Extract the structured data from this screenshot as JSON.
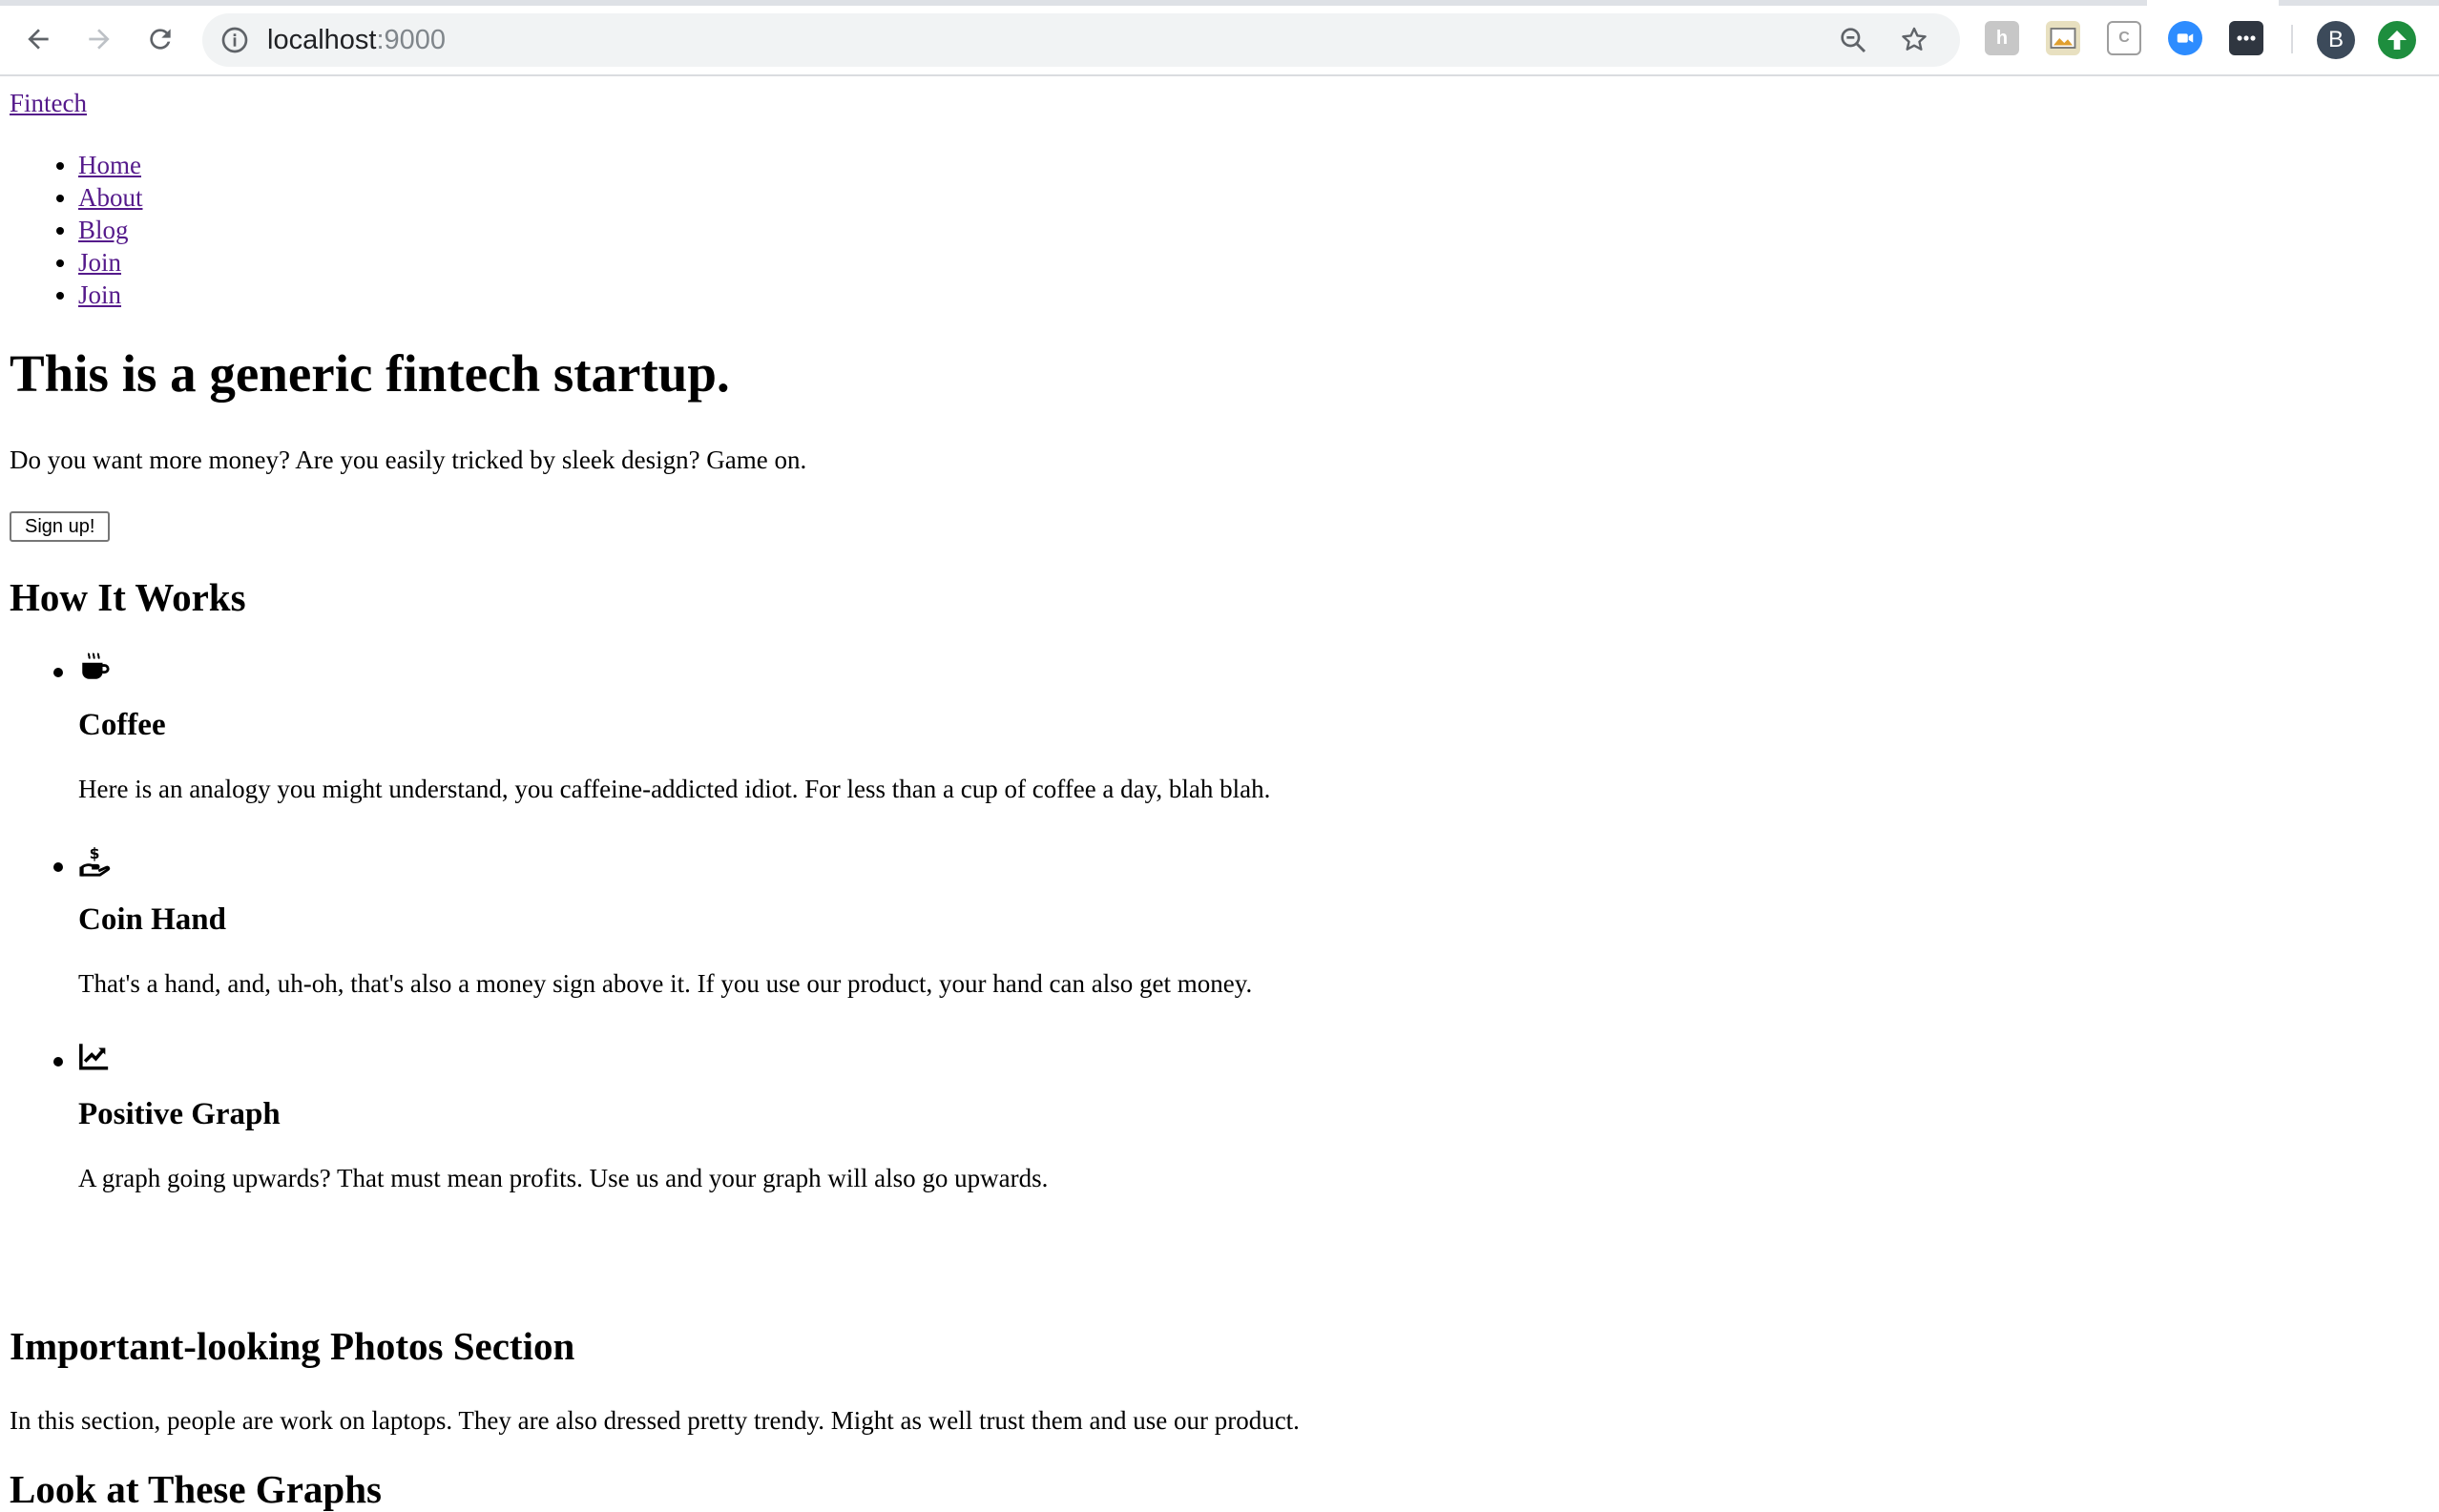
{
  "browser": {
    "url_host": "localhost",
    "url_port": ":9000",
    "avatar_initial": "B"
  },
  "site": {
    "brand": "Fintech",
    "nav": [
      "Home",
      "About",
      "Blog",
      "Join",
      "Join"
    ]
  },
  "hero": {
    "title": "This is a generic fintech startup.",
    "lead": "Do you want more money? Are you easily tricked by sleek design? Game on.",
    "button": "Sign up!"
  },
  "how": {
    "title": "How It Works",
    "steps": [
      {
        "icon": "coffee-icon",
        "title": "Coffee",
        "text": "Here is an analogy you might understand, you caffeine-addicted idiot. For less than a cup of coffee a day, blah blah."
      },
      {
        "icon": "coin-hand-icon",
        "title": "Coin Hand",
        "text": "That's a hand, and, uh-oh, that's also a money sign above it. If you use our product, your hand can also get money."
      },
      {
        "icon": "positive-graph-icon",
        "title": "Positive Graph",
        "text": "A graph going upwards? That must mean profits. Use us and your graph will also go upwards."
      }
    ]
  },
  "photos": {
    "title": "Important-looking Photos Section",
    "text": "In this section, people are work on laptops. They are also dressed pretty trendy. Might as well trust them and use our product."
  },
  "next_section": {
    "title": "Look at These Graphs"
  }
}
